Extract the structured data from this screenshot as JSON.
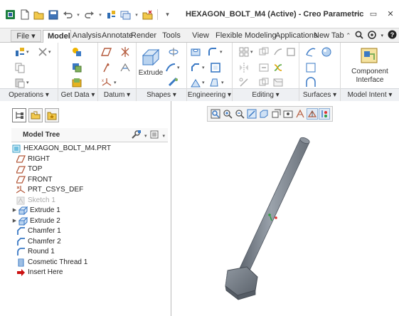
{
  "window": {
    "title": "HEXAGON_BOLT_M4 (Active) - Creo Parametric",
    "minimize": "–",
    "maximize": "▭",
    "close": "✕"
  },
  "quick_access": [
    "new-icon",
    "open-icon",
    "save-icon",
    "undo-icon",
    "redo-icon",
    "regenerate-icon",
    "windows-icon",
    "close-window-icon",
    "customize-icon"
  ],
  "tabs": [
    {
      "label": "File ▾"
    },
    {
      "label": "Model"
    },
    {
      "label": "Analysis"
    },
    {
      "label": "Annotate"
    },
    {
      "label": "Render"
    },
    {
      "label": "Tools"
    },
    {
      "label": "View"
    },
    {
      "label": "Flexible Modeling"
    },
    {
      "label": "Applications"
    },
    {
      "label": "New Tab"
    }
  ],
  "ribbon": {
    "groups": [
      {
        "label": "Operations ▾"
      },
      {
        "label": "Get Data ▾"
      },
      {
        "label": "Datum ▾"
      },
      {
        "label": "Shapes ▾"
      },
      {
        "label": "Engineering ▾"
      },
      {
        "label": "Editing ▾"
      },
      {
        "label": "Surfaces ▾"
      },
      {
        "label": "Model Intent ▾"
      }
    ],
    "extrude_label": "Extrude",
    "component_interface_label": "Component Interface"
  },
  "model_tree": {
    "title": "Model Tree",
    "items": [
      {
        "label": "HEXAGON_BOLT_M4.PRT",
        "icon": "part-icon"
      },
      {
        "label": "RIGHT",
        "icon": "datum-plane-icon"
      },
      {
        "label": "TOP",
        "icon": "datum-plane-icon"
      },
      {
        "label": "FRONT",
        "icon": "datum-plane-icon"
      },
      {
        "label": "PRT_CSYS_DEF",
        "icon": "csys-icon"
      },
      {
        "label": "Sketch 1",
        "icon": "sketch-icon"
      },
      {
        "label": "Extrude 1",
        "icon": "extrude-icon"
      },
      {
        "label": "Extrude 2",
        "icon": "extrude-icon"
      },
      {
        "label": "Chamfer 1",
        "icon": "chamfer-icon"
      },
      {
        "label": "Chamfer 2",
        "icon": "chamfer-icon"
      },
      {
        "label": "Round 1",
        "icon": "round-icon"
      },
      {
        "label": "Cosmetic Thread 1",
        "icon": "thread-icon"
      },
      {
        "label": "Insert Here",
        "icon": "insert-arrow-icon"
      }
    ]
  },
  "colors": {
    "accent": "#1e6fbf",
    "model_body": "#7e8690",
    "insert_arrow": "#cc1111"
  }
}
